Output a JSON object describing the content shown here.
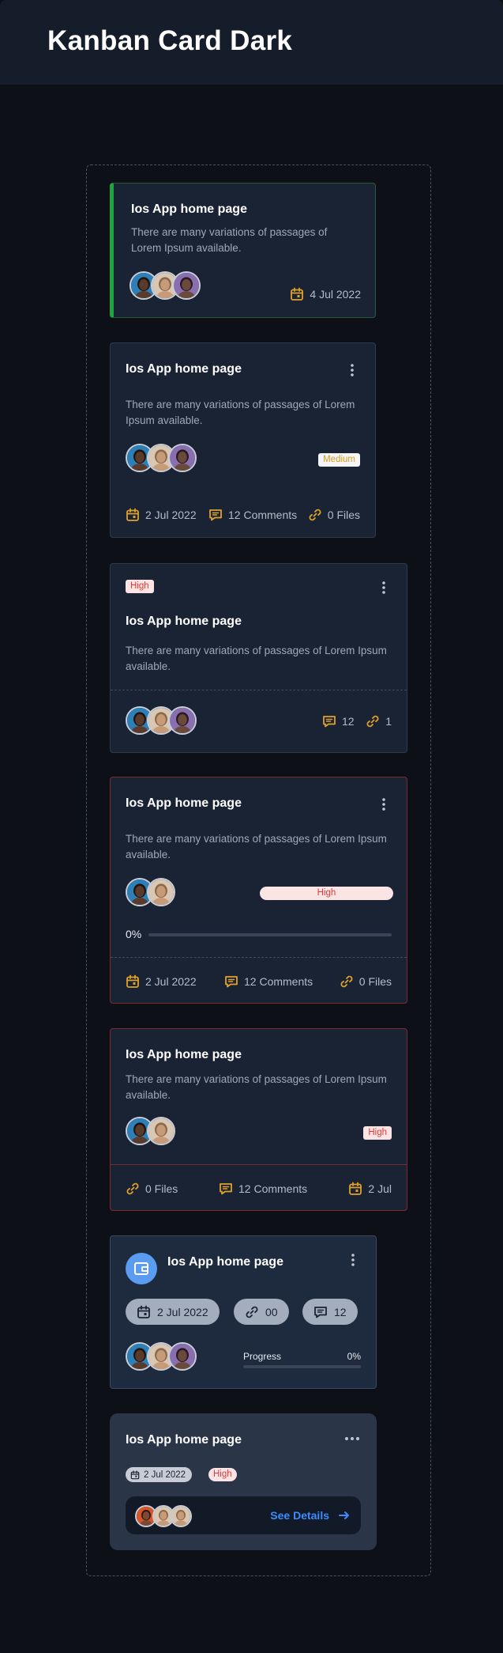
{
  "page": {
    "title": "Kanban Card Dark"
  },
  "colors": {
    "accent_green": "#1fa53d",
    "icon_orange": "#e0a12a",
    "danger_red": "#dc3b3b",
    "link_blue": "#3d8bff"
  },
  "card1": {
    "title": "Ios App home page",
    "description": "There are many variations of passages of Lorem Ipsum available.",
    "date": "4 Jul 2022"
  },
  "card2": {
    "title": "Ios App home page",
    "description": "There are many variations of passages of Lorem Ipsum available.",
    "badge": "Medium",
    "date": "2 Jul 2022",
    "comments": "12 Comments",
    "files": "0 Files"
  },
  "card3": {
    "badge": "High",
    "title": "Ios App home page",
    "description": "There are many variations of passages of Lorem Ipsum available.",
    "comments": "12",
    "links": "1"
  },
  "card4": {
    "title": "Ios App home page",
    "description": "There are many variations of passages of Lorem Ipsum available.",
    "badge": "High",
    "progress_label": "0%",
    "progress": 0,
    "date": "2 Jul 2022",
    "comments": "12 Comments",
    "files": "0 Files"
  },
  "card5": {
    "title": "Ios App home page",
    "description": "There are many variations of passages of Lorem Ipsum available.",
    "badge": "High",
    "files": "0 Files",
    "comments": "12 Comments",
    "date": "2 Jul"
  },
  "card6": {
    "title": "Ios App home page",
    "date": "2 Jul 2022",
    "links": "00",
    "comments": "12",
    "progress_title": "Progress",
    "progress_label": "0%",
    "progress": 0
  },
  "card7": {
    "title": "Ios App home page",
    "date": "2 Jul 2022",
    "badge": "High",
    "cta": "See Details"
  },
  "icons": [
    "calendar-icon",
    "comment-icon",
    "link-icon",
    "kebab-menu-icon",
    "more-horizontal-icon",
    "wallet-icon",
    "arrow-right-icon"
  ]
}
